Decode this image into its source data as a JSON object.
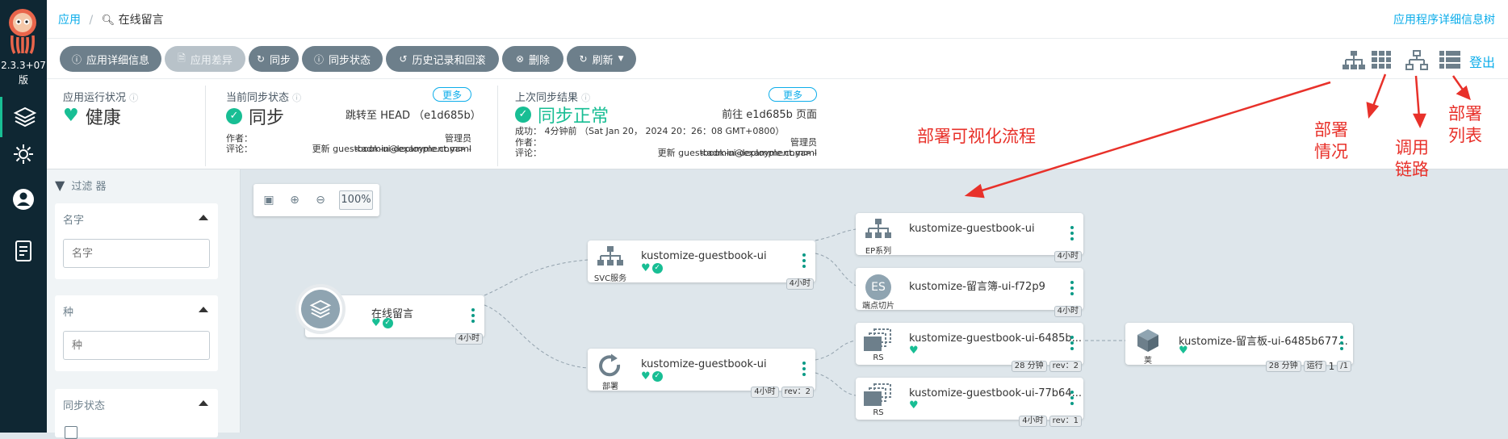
{
  "nav": {
    "version_line1": "2.3.3+07",
    "version_line2": "版",
    "items": [
      "applications-icon",
      "settings-icon",
      "user-icon",
      "docs-icon"
    ]
  },
  "breadcrumb": {
    "root": "应用",
    "current": "在线留言"
  },
  "topbar": {
    "right_title": "应用程序详细信息树"
  },
  "toolbar": {
    "buttons": [
      "应用详细信息",
      "应用差异",
      "同步",
      "同步状态",
      "历史记录和回滚",
      "删除",
      "刷新"
    ],
    "logout": "登出"
  },
  "status": {
    "health_title": "应用运行状况",
    "health_value": "健康",
    "sync_title": "当前同步状态",
    "sync_value": "同步",
    "sync_more": "更多",
    "sync_target": "跳转至 HEAD （e1d685b）",
    "sync_author_label": "作者：",
    "sync_author_value": "管理员<admin@example.com> -",
    "sync_comment_label": "评论：",
    "sync_comment_value": "更新 guestbook-ui-deployment.yaml",
    "last_title": "上次同步结果",
    "last_value": "同步正常",
    "last_more": "更多",
    "last_target": "前往 e1d685b 页面",
    "last_success": "成功：  4分钟前 （Sat Jan 20， 2024 20：26：08 GMT+0800）",
    "last_author_label": "作者：",
    "last_author_value": "管理员<admin@example.com> -",
    "last_comment_label": "评论：",
    "last_comment_value": "更新 guestbook-ui-deployment.yaml"
  },
  "annotations": {
    "flow": "部署可视化流程",
    "deploy_1": "部署",
    "deploy_2": "情况",
    "chain_1": "调用",
    "chain_2": "链路",
    "list_1": "部署",
    "list_2": "列表"
  },
  "filters": {
    "header": "过滤 器",
    "name_label": "名字",
    "name_placeholder": "名字",
    "kind_label": "种",
    "kind_placeholder": "种",
    "sync_label": "同步状态"
  },
  "zoom": {
    "level": "100%"
  },
  "graph": {
    "app": {
      "name": "在线留言",
      "age": "4小时"
    },
    "svc": {
      "name": "kustomize-guestbook-ui",
      "kind": "SVC服务",
      "age": "4小时"
    },
    "deploy": {
      "name": "kustomize-guestbook-ui",
      "kind": "部署",
      "age": "4小时",
      "rev": "rev：2"
    },
    "ep": {
      "name": "kustomize-guestbook-ui",
      "kind": "EP系列",
      "age": "4小时"
    },
    "es": {
      "name": "kustomize-留言簿-ui-f72p9",
      "kind": "端点切片",
      "badge": "ES",
      "age": "4小时"
    },
    "rs1": {
      "name": "kustomize-guestbook-ui-6485b...",
      "kind": "RS",
      "age": "28 分钟",
      "rev": "rev：2"
    },
    "rs2": {
      "name": "kustomize-guestbook-ui-77b64...",
      "kind": "RS",
      "age": "4小时",
      "rev": "rev：1"
    },
    "pod": {
      "name": "kustomize-留言板-ui-6485b677...",
      "kind": "荚",
      "age": "28 分钟",
      "state": "运行",
      "count": "1",
      "total": "/1"
    }
  },
  "colors": {
    "accent": "#0dadea",
    "healthy": "#18be94",
    "annotation": "#e8312a",
    "nav_bg": "#0f2733"
  }
}
